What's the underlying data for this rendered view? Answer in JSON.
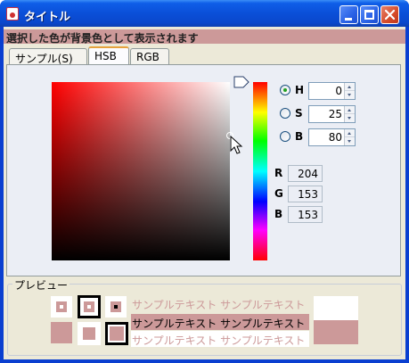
{
  "window": {
    "title": "タイトル",
    "icon": "java-app-icon",
    "controls": [
      "minimize-icon",
      "maximize-icon",
      "close-icon"
    ]
  },
  "status": {
    "text": "選択した色が背景色として表示されます",
    "background": "#cc9999"
  },
  "tabs": [
    {
      "label": "サンプル(S)",
      "selected": false
    },
    {
      "label": "HSB",
      "selected": true
    },
    {
      "label": "RGB",
      "selected": false
    }
  ],
  "hsb": {
    "h": {
      "label": "H",
      "value": "0",
      "selected": true
    },
    "s": {
      "label": "S",
      "value": "25",
      "selected": false
    },
    "b": {
      "label": "B",
      "value": "80",
      "selected": false
    }
  },
  "rgb": {
    "r": {
      "label": "R",
      "value": "204"
    },
    "g": {
      "label": "G",
      "value": "153"
    },
    "b": {
      "label": "B",
      "value": "153"
    }
  },
  "preview": {
    "title": "プレビュー",
    "sample_text": "サンプルテキスト サンプルテキスト",
    "selected_color": "#cc9999"
  }
}
